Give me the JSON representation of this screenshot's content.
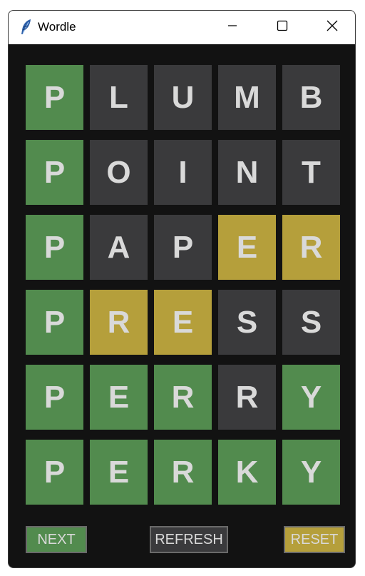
{
  "window": {
    "title": "Wordle"
  },
  "icons": {
    "app": "feather-icon",
    "minimize": "minimize-icon",
    "maximize": "maximize-icon",
    "close": "close-icon"
  },
  "colors": {
    "correct": "#528b4e",
    "present": "#b59f3b",
    "absent": "#3a3a3c",
    "letter": "#d9d9d9",
    "background": "#121212"
  },
  "grid": {
    "rows": [
      {
        "tiles": [
          {
            "letter": "P",
            "state": "correct"
          },
          {
            "letter": "L",
            "state": "absent"
          },
          {
            "letter": "U",
            "state": "absent"
          },
          {
            "letter": "M",
            "state": "absent"
          },
          {
            "letter": "B",
            "state": "absent"
          }
        ]
      },
      {
        "tiles": [
          {
            "letter": "P",
            "state": "correct"
          },
          {
            "letter": "O",
            "state": "absent"
          },
          {
            "letter": "I",
            "state": "absent"
          },
          {
            "letter": "N",
            "state": "absent"
          },
          {
            "letter": "T",
            "state": "absent"
          }
        ]
      },
      {
        "tiles": [
          {
            "letter": "P",
            "state": "correct"
          },
          {
            "letter": "A",
            "state": "absent"
          },
          {
            "letter": "P",
            "state": "absent"
          },
          {
            "letter": "E",
            "state": "present"
          },
          {
            "letter": "R",
            "state": "present"
          }
        ]
      },
      {
        "tiles": [
          {
            "letter": "P",
            "state": "correct"
          },
          {
            "letter": "R",
            "state": "present"
          },
          {
            "letter": "E",
            "state": "present"
          },
          {
            "letter": "S",
            "state": "absent"
          },
          {
            "letter": "S",
            "state": "absent"
          }
        ]
      },
      {
        "tiles": [
          {
            "letter": "P",
            "state": "correct"
          },
          {
            "letter": "E",
            "state": "correct"
          },
          {
            "letter": "R",
            "state": "correct"
          },
          {
            "letter": "R",
            "state": "absent"
          },
          {
            "letter": "Y",
            "state": "correct"
          }
        ]
      },
      {
        "tiles": [
          {
            "letter": "P",
            "state": "correct"
          },
          {
            "letter": "E",
            "state": "correct"
          },
          {
            "letter": "R",
            "state": "correct"
          },
          {
            "letter": "K",
            "state": "correct"
          },
          {
            "letter": "Y",
            "state": "correct"
          }
        ]
      }
    ]
  },
  "buttons": {
    "next": "NEXT",
    "refresh": "REFRESH",
    "reset": "RESET"
  }
}
